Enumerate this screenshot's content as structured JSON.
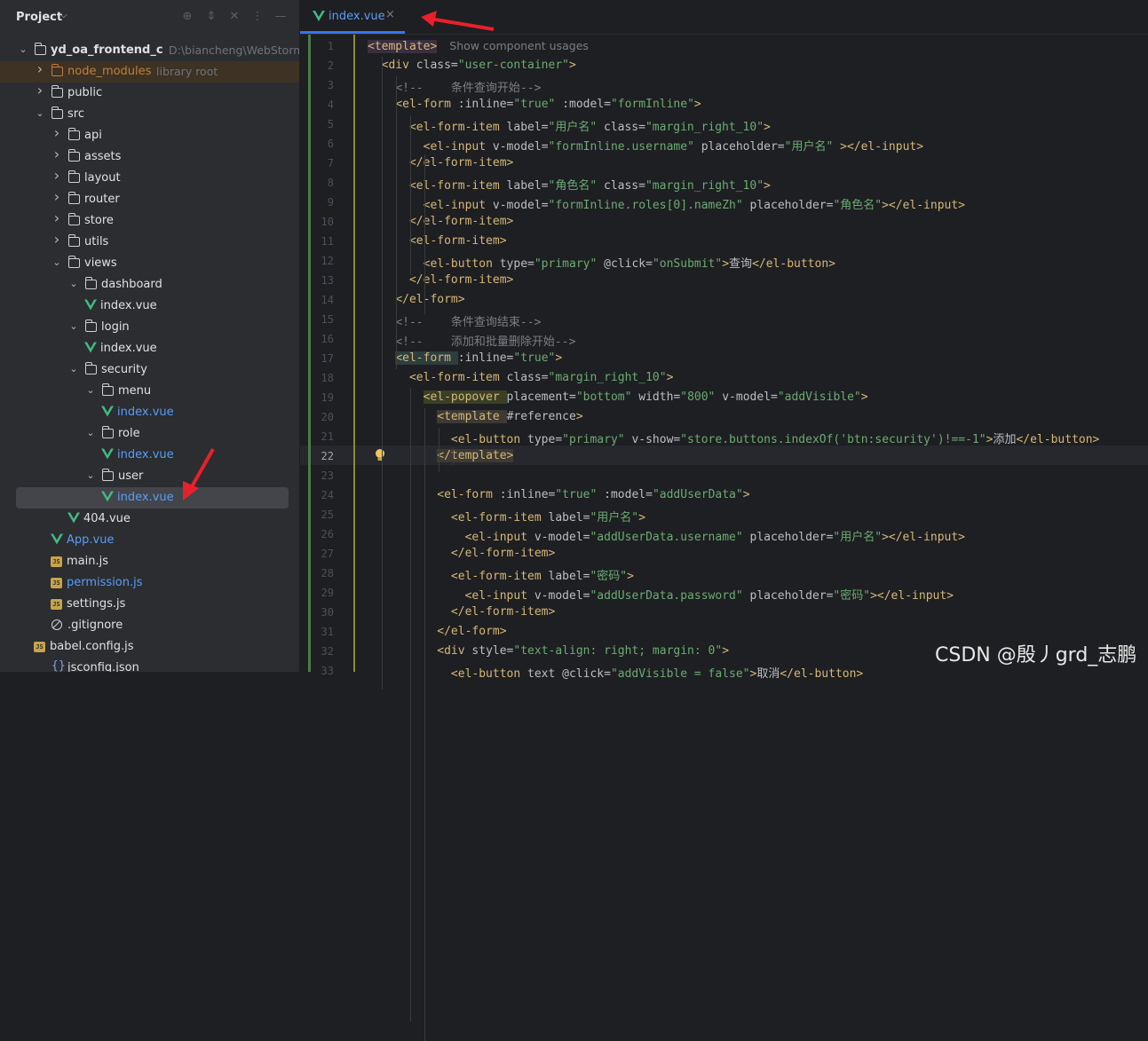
{
  "project_panel": {
    "title": "Project",
    "header_icons": [
      "crosshair-icon",
      "expand-icon",
      "collapse-icon",
      "more-icon",
      "minimize-icon"
    ],
    "tree": [
      {
        "label": "yd_oa_frontend_c",
        "hint": "D:\\biancheng\\WebStormProj",
        "kind": "folder",
        "depth": 0,
        "expanded": true,
        "bold": true
      },
      {
        "label": "node_modules",
        "hint": "library root",
        "kind": "folder",
        "depth": 1,
        "expanded": false,
        "color": "orange"
      },
      {
        "label": "public",
        "kind": "folder",
        "depth": 1,
        "expanded": false
      },
      {
        "label": "src",
        "kind": "folder",
        "depth": 1,
        "expanded": true
      },
      {
        "label": "api",
        "kind": "folder",
        "depth": 2,
        "expanded": false
      },
      {
        "label": "assets",
        "kind": "folder",
        "depth": 2,
        "expanded": false
      },
      {
        "label": "layout",
        "kind": "folder",
        "depth": 2,
        "expanded": false
      },
      {
        "label": "router",
        "kind": "folder",
        "depth": 2,
        "expanded": false
      },
      {
        "label": "store",
        "kind": "folder",
        "depth": 2,
        "expanded": false
      },
      {
        "label": "utils",
        "kind": "folder",
        "depth": 2,
        "expanded": false
      },
      {
        "label": "views",
        "kind": "folder",
        "depth": 2,
        "expanded": true
      },
      {
        "label": "dashboard",
        "kind": "folder",
        "depth": 3,
        "expanded": true
      },
      {
        "label": "index.vue",
        "kind": "vue",
        "depth": 4
      },
      {
        "label": "login",
        "kind": "folder",
        "depth": 3,
        "expanded": true
      },
      {
        "label": "index.vue",
        "kind": "vue",
        "depth": 4
      },
      {
        "label": "security",
        "kind": "folder",
        "depth": 3,
        "expanded": true
      },
      {
        "label": "menu",
        "kind": "folder",
        "depth": 4,
        "expanded": true
      },
      {
        "label": "index.vue",
        "kind": "vue",
        "depth": 5,
        "color": "blue"
      },
      {
        "label": "role",
        "kind": "folder",
        "depth": 4,
        "expanded": true
      },
      {
        "label": "index.vue",
        "kind": "vue",
        "depth": 5,
        "color": "blue"
      },
      {
        "label": "user",
        "kind": "folder",
        "depth": 4,
        "expanded": true
      },
      {
        "label": "index.vue",
        "kind": "vue",
        "depth": 5,
        "color": "blue",
        "selected": true
      },
      {
        "label": "404.vue",
        "kind": "vue",
        "depth": 3
      },
      {
        "label": "App.vue",
        "kind": "vue",
        "depth": 2,
        "color": "blue"
      },
      {
        "label": "main.js",
        "kind": "js",
        "depth": 2
      },
      {
        "label": "permission.js",
        "kind": "js",
        "depth": 2,
        "color": "blue"
      },
      {
        "label": "settings.js",
        "kind": "js",
        "depth": 2
      },
      {
        "label": ".gitignore",
        "kind": "ignore",
        "depth": 1
      },
      {
        "label": "babel.config.js",
        "kind": "js",
        "depth": 1
      },
      {
        "label": "jsconfig.json",
        "kind": "json",
        "depth": 1
      }
    ]
  },
  "tabs": [
    {
      "label": "index.vue",
      "active": true,
      "close": "×"
    }
  ],
  "editor": {
    "current_line": 22,
    "inlay_hint": "Show component usages",
    "lines": [
      [
        [
          "t",
          "<template>"
        ]
      ],
      [
        [
          "p",
          "  "
        ],
        [
          "t",
          "<div "
        ],
        [
          "a",
          "class="
        ],
        [
          "s",
          "\"user-container\""
        ],
        [
          "t",
          ">"
        ]
      ],
      [
        [
          "p",
          "    "
        ],
        [
          "c",
          "<!--    条件查询开始-->"
        ]
      ],
      [
        [
          "p",
          "    "
        ],
        [
          "t",
          "<el-form "
        ],
        [
          "a",
          ":inline="
        ],
        [
          "s",
          "\"true\" "
        ],
        [
          "a",
          ":model="
        ],
        [
          "s",
          "\"formInline\""
        ],
        [
          "t",
          ">"
        ]
      ],
      [
        [
          "p",
          "      "
        ],
        [
          "t",
          "<el-form-item "
        ],
        [
          "a",
          "label="
        ],
        [
          "s",
          "\"用户名\" "
        ],
        [
          "a",
          "class="
        ],
        [
          "s",
          "\"margin_right_10\""
        ],
        [
          "t",
          ">"
        ]
      ],
      [
        [
          "p",
          "        "
        ],
        [
          "t",
          "<el-input "
        ],
        [
          "a",
          "v-model="
        ],
        [
          "s",
          "\"formInline.username\" "
        ],
        [
          "a",
          "placeholder="
        ],
        [
          "s",
          "\"用户名\" "
        ],
        [
          "t",
          "></el-input>"
        ]
      ],
      [
        [
          "p",
          "      "
        ],
        [
          "t",
          "</el-form-item>"
        ]
      ],
      [
        [
          "p",
          "      "
        ],
        [
          "t",
          "<el-form-item "
        ],
        [
          "a",
          "label="
        ],
        [
          "s",
          "\"角色名\" "
        ],
        [
          "a",
          "class="
        ],
        [
          "s",
          "\"margin_right_10\""
        ],
        [
          "t",
          ">"
        ]
      ],
      [
        [
          "p",
          "        "
        ],
        [
          "t",
          "<el-input "
        ],
        [
          "a",
          "v-model="
        ],
        [
          "s",
          "\"formInline.roles[0].nameZh\" "
        ],
        [
          "a",
          "placeholder="
        ],
        [
          "s",
          "\"角色名\""
        ],
        [
          "t",
          "></el-input>"
        ]
      ],
      [
        [
          "p",
          "      "
        ],
        [
          "t",
          "</el-form-item>"
        ]
      ],
      [
        [
          "p",
          "      "
        ],
        [
          "t",
          "<el-form-item>"
        ]
      ],
      [
        [
          "p",
          "        "
        ],
        [
          "t",
          "<el-button "
        ],
        [
          "a",
          "type="
        ],
        [
          "s",
          "\"primary\" "
        ],
        [
          "a",
          "@click="
        ],
        [
          "s",
          "\"onSubmit\""
        ],
        [
          "t",
          ">"
        ],
        [
          "p",
          "查询"
        ],
        [
          "t",
          "</el-button>"
        ]
      ],
      [
        [
          "p",
          "      "
        ],
        [
          "t",
          "</el-form-item>"
        ]
      ],
      [
        [
          "p",
          "    "
        ],
        [
          "t",
          "</el-form>"
        ]
      ],
      [
        [
          "p",
          "    "
        ],
        [
          "c",
          "<!--    条件查询结束-->"
        ]
      ],
      [
        [
          "p",
          "    "
        ],
        [
          "c",
          "<!--    添加和批量删除开始-->"
        ]
      ],
      [
        [
          "p",
          "    "
        ],
        [
          "t",
          "<el-form "
        ],
        [
          "a",
          ":inline="
        ],
        [
          "s",
          "\"true\""
        ],
        [
          "t",
          ">"
        ]
      ],
      [
        [
          "p",
          "      "
        ],
        [
          "t",
          "<el-form-item "
        ],
        [
          "a",
          "class="
        ],
        [
          "s",
          "\"margin_right_10\""
        ],
        [
          "t",
          ">"
        ]
      ],
      [
        [
          "p",
          "        "
        ],
        [
          "t",
          "<el-popover "
        ],
        [
          "a",
          "placement="
        ],
        [
          "s",
          "\"bottom\" "
        ],
        [
          "a",
          "width="
        ],
        [
          "s",
          "\"800\" "
        ],
        [
          "a",
          "v-model="
        ],
        [
          "s",
          "\"addVisible\""
        ],
        [
          "t",
          ">"
        ]
      ],
      [
        [
          "p",
          "          "
        ],
        [
          "t",
          "<template "
        ],
        [
          "a",
          "#reference"
        ],
        [
          "t",
          ">"
        ]
      ],
      [
        [
          "p",
          "            "
        ],
        [
          "t",
          "<el-button "
        ],
        [
          "a",
          "type="
        ],
        [
          "s",
          "\"primary\" "
        ],
        [
          "a",
          "v-show="
        ],
        [
          "s",
          "\"store.buttons.indexOf('btn:security')!==-1\""
        ],
        [
          "t",
          ">"
        ],
        [
          "p",
          "添加"
        ],
        [
          "t",
          "</el-button>"
        ]
      ],
      [
        [
          "p",
          "          "
        ],
        [
          "t",
          "</template>"
        ]
      ],
      [
        [
          "p",
          ""
        ]
      ],
      [
        [
          "p",
          "          "
        ],
        [
          "t",
          "<el-form "
        ],
        [
          "a",
          ":inline="
        ],
        [
          "s",
          "\"true\" "
        ],
        [
          "a",
          ":model="
        ],
        [
          "s",
          "\"addUserData\""
        ],
        [
          "t",
          ">"
        ]
      ],
      [
        [
          "p",
          "            "
        ],
        [
          "t",
          "<el-form-item "
        ],
        [
          "a",
          "label="
        ],
        [
          "s",
          "\"用户名\""
        ],
        [
          "t",
          ">"
        ]
      ],
      [
        [
          "p",
          "              "
        ],
        [
          "t",
          "<el-input "
        ],
        [
          "a",
          "v-model="
        ],
        [
          "s",
          "\"addUserData.username\" "
        ],
        [
          "a",
          "placeholder="
        ],
        [
          "s",
          "\"用户名\""
        ],
        [
          "t",
          "></el-input>"
        ]
      ],
      [
        [
          "p",
          "            "
        ],
        [
          "t",
          "</el-form-item>"
        ]
      ],
      [
        [
          "p",
          "            "
        ],
        [
          "t",
          "<el-form-item "
        ],
        [
          "a",
          "label="
        ],
        [
          "s",
          "\"密码\""
        ],
        [
          "t",
          ">"
        ]
      ],
      [
        [
          "p",
          "              "
        ],
        [
          "t",
          "<el-input "
        ],
        [
          "a",
          "v-model="
        ],
        [
          "s",
          "\"addUserData.password\" "
        ],
        [
          "a",
          "placeholder="
        ],
        [
          "s",
          "\"密码\""
        ],
        [
          "t",
          "></el-input>"
        ]
      ],
      [
        [
          "p",
          "            "
        ],
        [
          "t",
          "</el-form-item>"
        ]
      ],
      [
        [
          "p",
          "          "
        ],
        [
          "t",
          "</el-form>"
        ]
      ],
      [
        [
          "p",
          "          "
        ],
        [
          "t",
          "<div "
        ],
        [
          "a",
          "style="
        ],
        [
          "s",
          "\"text-align: right; margin: 0\""
        ],
        [
          "t",
          ">"
        ]
      ],
      [
        [
          "p",
          "            "
        ],
        [
          "t",
          "<el-button "
        ],
        [
          "a",
          "text "
        ],
        [
          "a",
          "@click="
        ],
        [
          "s",
          "\"addVisible = false\""
        ],
        [
          "t",
          ">"
        ],
        [
          "p",
          "取消"
        ],
        [
          "t",
          "</el-button>"
        ]
      ]
    ]
  },
  "watermark": "CSDN @殷丿grd_志鹏",
  "colors": {
    "accent": "#3574f0",
    "vue_green": "#41b883",
    "arrow_red": "#e8202a"
  }
}
